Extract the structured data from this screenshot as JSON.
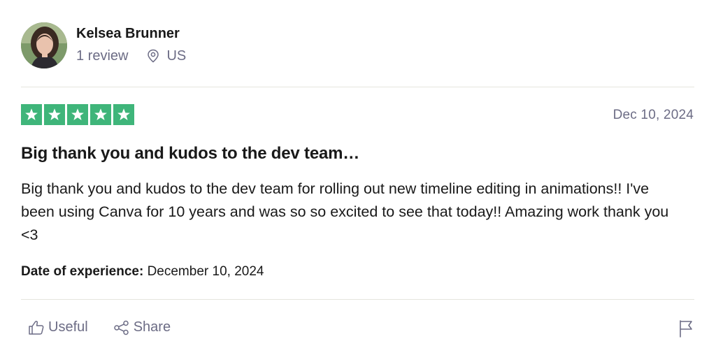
{
  "reviewer": {
    "name": "Kelsea Brunner",
    "review_count": "1 review",
    "country": "US"
  },
  "rating": {
    "stars": 5,
    "max_stars": 5,
    "color": "#3fb57a"
  },
  "review": {
    "date": "Dec 10, 2024",
    "title": "Big thank you and kudos to the dev team…",
    "body": "Big thank you and kudos to the dev team for rolling out new timeline editing in animations!! I've been using Canva for 10 years and was so so excited to see that today!! Amazing work thank you <3",
    "experience_label": "Date of experience:",
    "experience_date": "December 10, 2024"
  },
  "actions": {
    "useful_label": "Useful",
    "share_label": "Share"
  },
  "icons": {
    "location": "location-pin-icon",
    "useful": "thumbs-up-icon",
    "share": "share-icon",
    "flag": "flag-icon",
    "star": "star-icon"
  }
}
